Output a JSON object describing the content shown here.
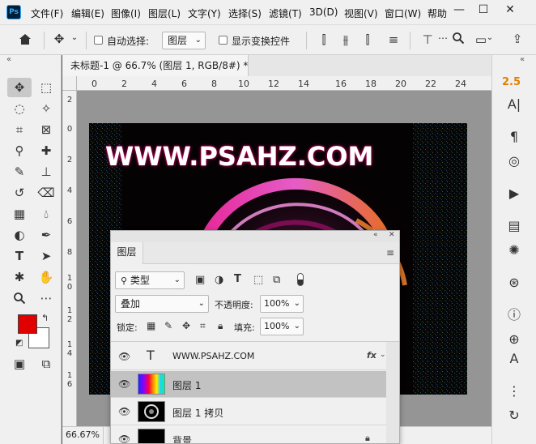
{
  "menu": {
    "items": [
      "文件(F)",
      "编辑(E)",
      "图像(I)",
      "图层(L)",
      "文字(Y)",
      "选择(S)",
      "滤镜(T)",
      "3D(D)",
      "视图(V)",
      "窗口(W)",
      "帮助"
    ],
    "logo": "Ps",
    "window_buttons": {
      "minimize": "—",
      "restore": "☐",
      "close": "✕"
    }
  },
  "options": {
    "auto_select_label": "自动选择:",
    "auto_select_value": "图层",
    "show_transform_label": "显示变换控件"
  },
  "document": {
    "tab_title": "未标题-1 @ 66.7% (图层 1, RGB/8#) *",
    "canvas_text": "WWW.PSAHZ.COM",
    "zoom_status": "66.67%",
    "ruler_h": [
      "0",
      "2",
      "4",
      "6",
      "8",
      "10",
      "12",
      "14",
      "16",
      "18",
      "20",
      "22",
      "24"
    ],
    "ruler_v": [
      "2",
      "0",
      "2",
      "4",
      "6",
      "8",
      "1\n0",
      "1\n2",
      "1\n4",
      "1\n6"
    ]
  },
  "right_dock": {
    "version_label": "2.5",
    "icons": [
      "char-a-icon",
      "paragraph-icon",
      "brush-preset-icon",
      "play-icon",
      "library-icon",
      "adjustments-icon",
      "channels-icon",
      "info-icon",
      "clone-source-icon",
      "glyph-a-icon",
      "properties-icon",
      "history-icon"
    ]
  },
  "colors": {
    "foreground": "#e00000",
    "background": "#ffffff"
  },
  "layers_panel": {
    "title": "图层",
    "filter_kind": "类型",
    "blend_mode": "叠加",
    "opacity_label": "不透明度:",
    "opacity_value": "100%",
    "lock_label": "锁定:",
    "fill_label": "填充:",
    "fill_value": "100%",
    "layers": [
      {
        "name": "WWW.PSAHZ.COM",
        "type": "text",
        "fx": "fx"
      },
      {
        "name": "图层 1",
        "type": "gradient",
        "selected": true
      },
      {
        "name": "图层 1 拷贝",
        "type": "ring"
      },
      {
        "name": "背景",
        "type": "background"
      }
    ]
  }
}
